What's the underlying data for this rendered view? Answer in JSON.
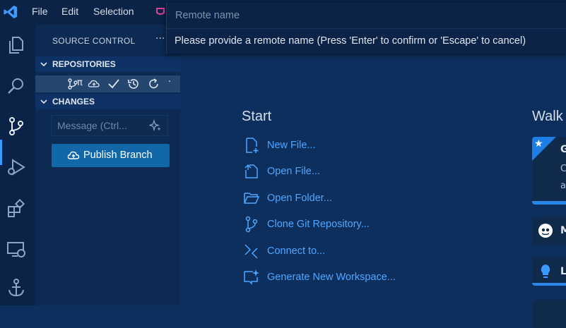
{
  "titlebar": {
    "menus": [
      "File",
      "Edit",
      "Selection"
    ]
  },
  "sidebar": {
    "title": "SOURCE CONTROL",
    "more": "···",
    "sections": {
      "repositories": "REPOSITORIES",
      "changes": "CHANGES"
    },
    "repo_branch_label": "π",
    "commit_placeholder": "Message (Ctrl...",
    "publish_label": "Publish Branch"
  },
  "welcome": {
    "start_heading": "Start",
    "walk_heading": "Walk",
    "start_items": [
      {
        "label": "New File...",
        "icon": "new-file-icon"
      },
      {
        "label": "Open File...",
        "icon": "open-file-icon"
      },
      {
        "label": "Open Folder...",
        "icon": "open-folder-icon"
      },
      {
        "label": "Clone Git Repository...",
        "icon": "git-branch-icon"
      },
      {
        "label": "Connect to...",
        "icon": "remote-icon"
      },
      {
        "label": "Generate New Workspace...",
        "icon": "sparkle-workspace-icon"
      }
    ],
    "walkthroughs": {
      "card_title": "G",
      "card_line1": "C",
      "card_line2": "a",
      "item2": "M",
      "item3": "L"
    }
  },
  "quick_input": {
    "placeholder": "Remote name",
    "message": "Please provide a remote name (Press 'Enter' to confirm or 'Escape' to cancel)"
  },
  "colors": {
    "accent": "#3d9bff",
    "link": "#4fa6ff",
    "button": "#1167a8",
    "background": "#0d2f5e"
  }
}
